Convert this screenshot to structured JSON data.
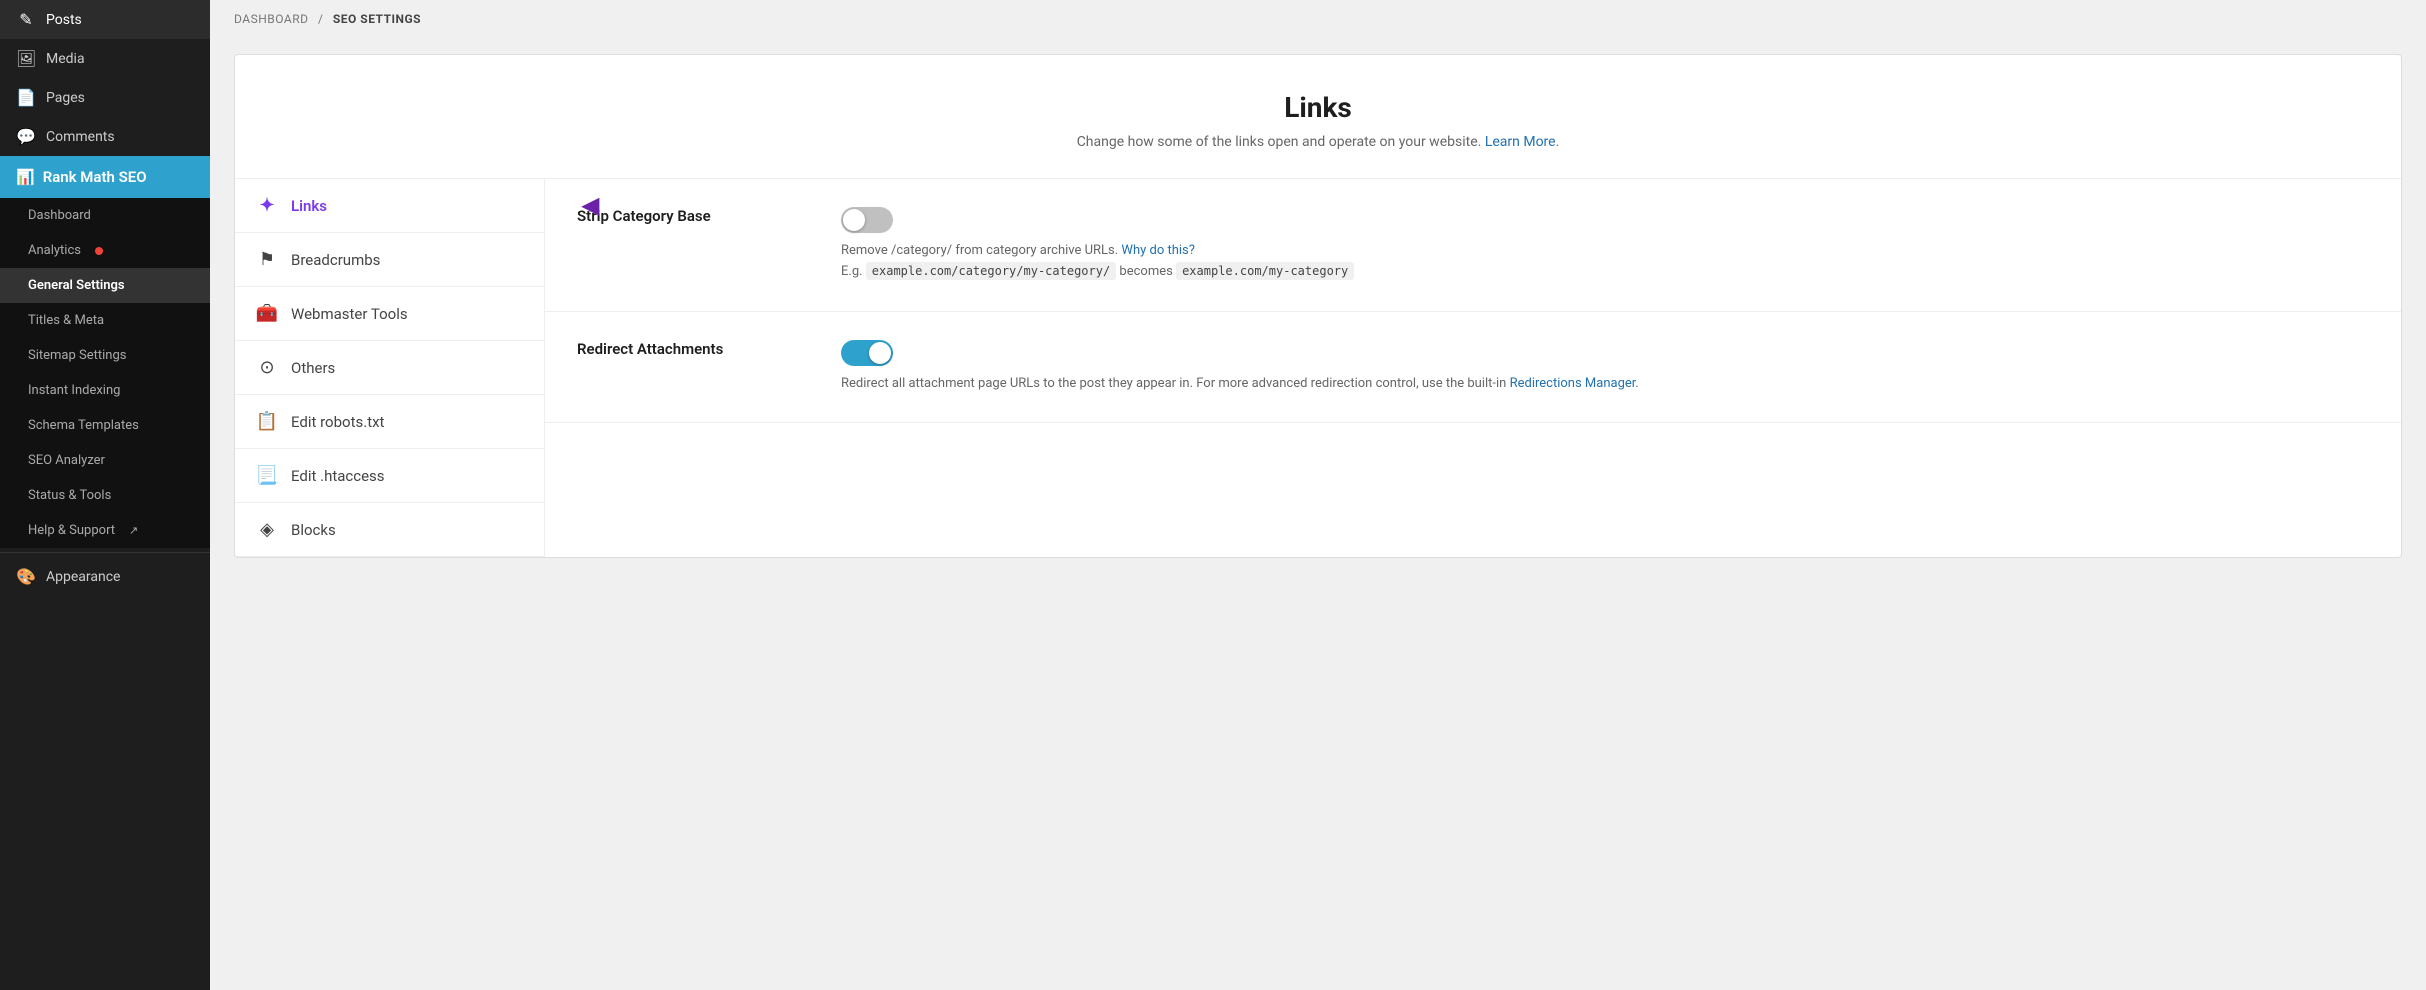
{
  "sidebar": {
    "items": [
      {
        "id": "posts",
        "label": "Posts",
        "icon": "📝"
      },
      {
        "id": "media",
        "label": "Media",
        "icon": "🖼"
      },
      {
        "id": "pages",
        "label": "Pages",
        "icon": "📄"
      },
      {
        "id": "comments",
        "label": "Comments",
        "icon": "💬"
      },
      {
        "id": "rank-math",
        "label": "Rank Math SEO",
        "icon": "📊",
        "active": true
      },
      {
        "id": "appearance",
        "label": "Appearance",
        "icon": "🎨"
      }
    ],
    "rankmath_submenu": [
      {
        "id": "dashboard",
        "label": "Dashboard"
      },
      {
        "id": "analytics",
        "label": "Analytics",
        "badge": true
      },
      {
        "id": "general-settings",
        "label": "General Settings",
        "active": true
      },
      {
        "id": "titles-meta",
        "label": "Titles & Meta"
      },
      {
        "id": "sitemap",
        "label": "Sitemap Settings"
      },
      {
        "id": "instant-indexing",
        "label": "Instant Indexing"
      },
      {
        "id": "schema-templates",
        "label": "Schema Templates"
      },
      {
        "id": "seo-analyzer",
        "label": "SEO Analyzer"
      },
      {
        "id": "status-tools",
        "label": "Status & Tools"
      },
      {
        "id": "help-support",
        "label": "Help & Support",
        "external": true
      }
    ]
  },
  "breadcrumb": {
    "items": [
      "DASHBOARD",
      "SEO SETTINGS"
    ]
  },
  "page": {
    "title": "Links",
    "description": "Change how some of the links open and operate on your website.",
    "learn_more": "Learn More"
  },
  "settings_nav": [
    {
      "id": "links",
      "label": "Links",
      "icon": "✦",
      "active": true
    },
    {
      "id": "breadcrumbs",
      "label": "Breadcrumbs",
      "icon": "⚑"
    },
    {
      "id": "webmaster-tools",
      "label": "Webmaster Tools",
      "icon": "🧰"
    },
    {
      "id": "others",
      "label": "Others",
      "icon": "⊙"
    },
    {
      "id": "edit-robots",
      "label": "Edit robots.txt",
      "icon": "📋"
    },
    {
      "id": "edit-htaccess",
      "label": "Edit .htaccess",
      "icon": "📃"
    },
    {
      "id": "blocks",
      "label": "Blocks",
      "icon": "◈"
    }
  ],
  "settings": [
    {
      "id": "strip-category-base",
      "label": "Strip Category Base",
      "toggle": false,
      "description_text": "Remove /category/ from category archive URLs.",
      "description_link": "Why do this?",
      "description_link_url": "#",
      "example": "E.g. example.com/category/my-category/ becomes example.com/my-category"
    },
    {
      "id": "redirect-attachments",
      "label": "Redirect Attachments",
      "toggle": true,
      "description_text": "Redirect all attachment page URLs to the post they appear in. For more advanced redirection control, use the built-in",
      "description_link": "Redirections Manager",
      "description_link_url": "#"
    }
  ]
}
